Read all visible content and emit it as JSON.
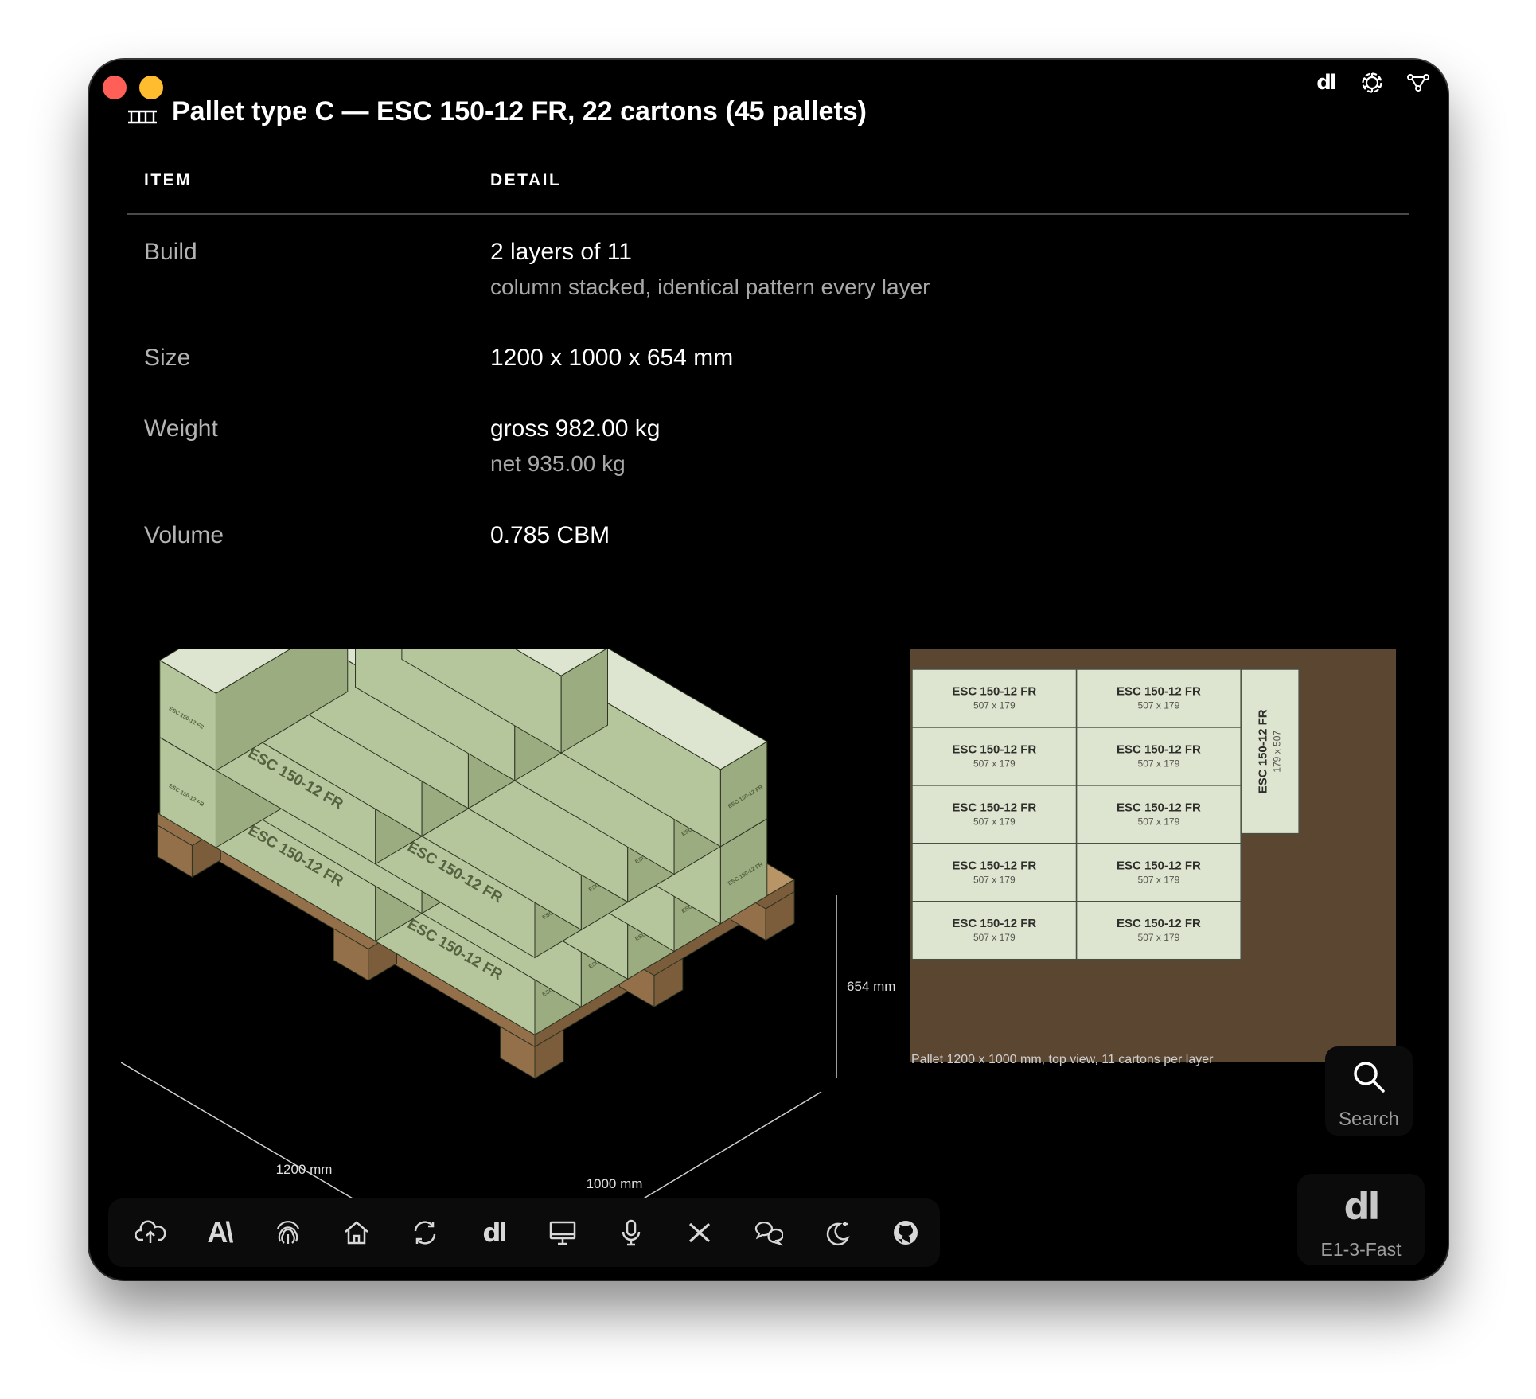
{
  "window": {
    "title": "Pallet type C — ESC 150-12 FR, 22 cartons (45 pallets)",
    "top_icons": [
      "dl-logo-icon",
      "openai-icon",
      "network-icon"
    ],
    "top_logo_text": "dl"
  },
  "table": {
    "headers": {
      "item": "ITEM",
      "detail": "DETAIL"
    },
    "rows": [
      {
        "label": "Build",
        "value": "2 layers of 11",
        "sub": "column stacked, identical pattern every layer"
      },
      {
        "label": "Size",
        "value": "1200 x 1000 x 654 mm",
        "sub": ""
      },
      {
        "label": "Weight",
        "value": "gross 982.00 kg",
        "sub": "net 935.00 kg"
      },
      {
        "label": "Volume",
        "value": "0.785 CBM",
        "sub": ""
      }
    ]
  },
  "iso_view": {
    "carton_label": "ESC 150-12 FR",
    "dim_height": "654 mm",
    "dim_length": "1200 mm",
    "dim_width": "1000 mm",
    "colors": {
      "carton_top": "#dde4d0",
      "carton_left": "#b5c59c",
      "carton_right": "#9aac80",
      "pallet_top": "#b89466",
      "pallet_left": "#94704a",
      "pallet_right": "#7b5c3b"
    }
  },
  "top_view": {
    "carton_label": "ESC 150-12 FR",
    "carton_dims": "507 x 179",
    "rotated_dims": "179 x 507",
    "caption": "Pallet 1200 x 1000 mm, top view, 11 cartons per layer",
    "colors": {
      "pallet": "#5a4631",
      "carton": "#dde4d0"
    }
  },
  "search": {
    "label": "Search"
  },
  "model": {
    "logo": "dl",
    "label": "E1-3-Fast"
  },
  "dock": {
    "dl_text": "dl",
    "aa_text": "A\\",
    "icons": [
      "cloud-upload-icon",
      "anthropic-icon",
      "fingerprint-icon",
      "home-icon",
      "sync-icon",
      "dl-icon",
      "monitor-icon",
      "microphone-icon",
      "x-icon",
      "chat-icon",
      "moon-icon",
      "github-icon"
    ]
  }
}
